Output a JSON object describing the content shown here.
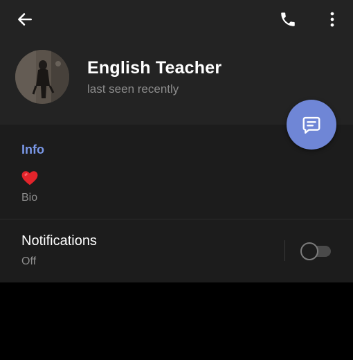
{
  "header": {
    "title": "English Teacher",
    "status": "last seen recently"
  },
  "icons": {
    "back": "arrow-left-icon",
    "call": "phone-icon",
    "more": "more-vertical-icon",
    "message": "message-icon"
  },
  "info": {
    "section_title": "Info",
    "bio_value": "❤️",
    "bio_label": "Bio"
  },
  "notifications": {
    "label": "Notifications",
    "state": "Off",
    "enabled": false
  },
  "colors": {
    "header_bg": "#232323",
    "section_bg": "#1c1c1c",
    "accent": "#7a98e8",
    "fab": "#6f86d6"
  }
}
